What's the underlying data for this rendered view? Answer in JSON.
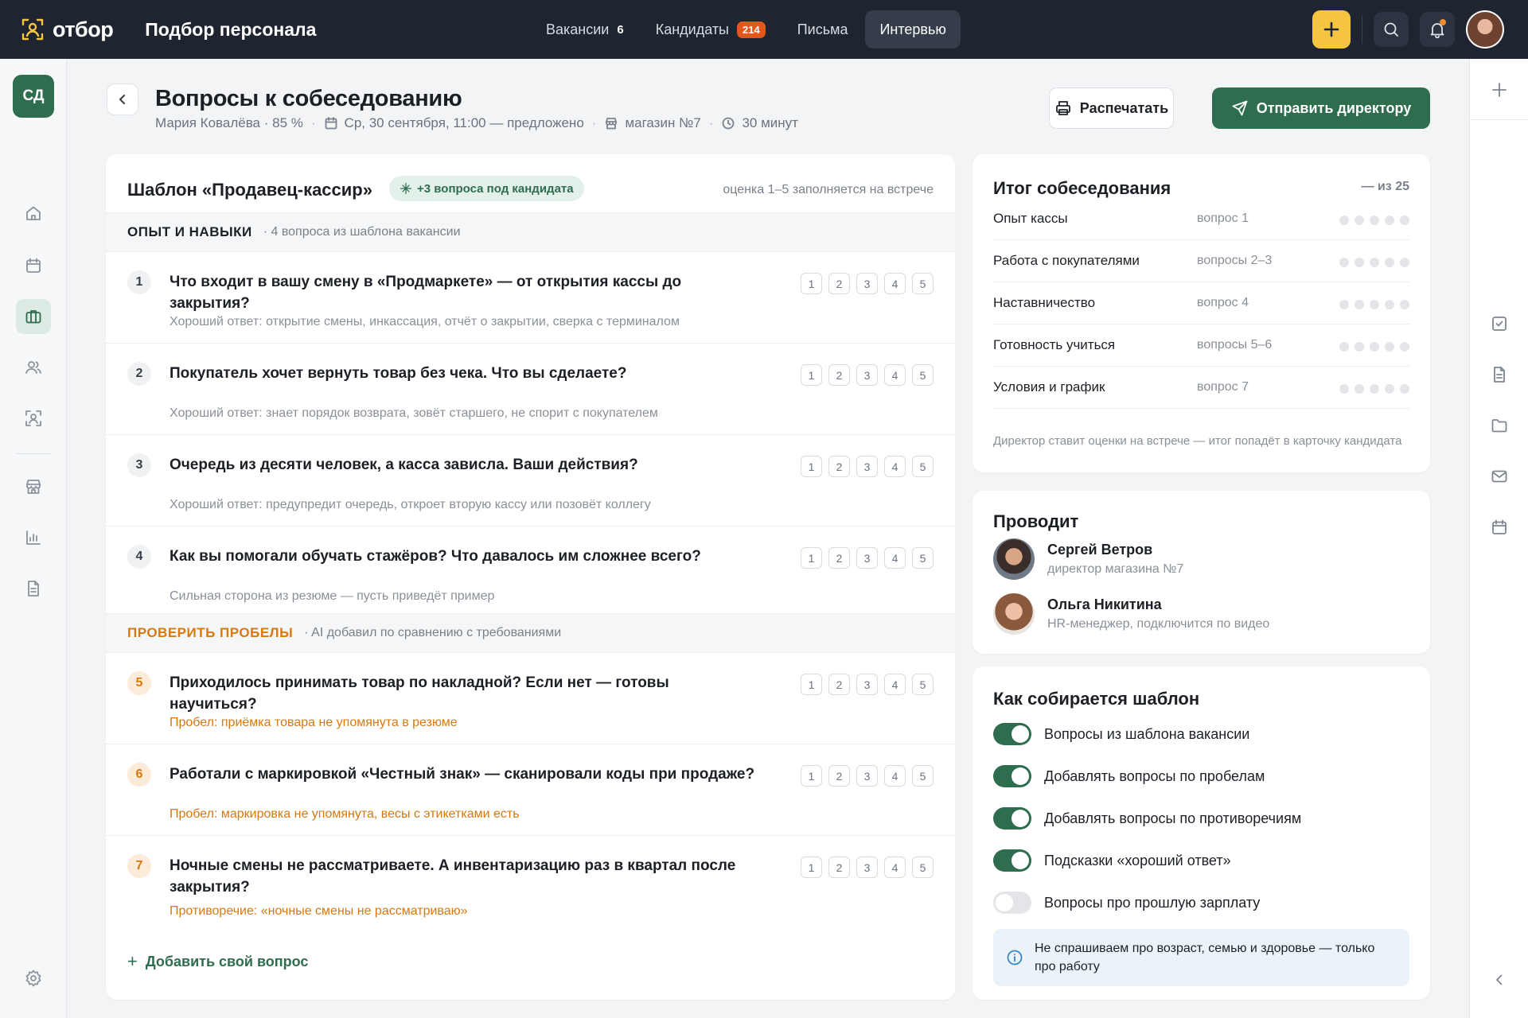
{
  "app": {
    "logo_text": "отбор",
    "title": "Подбор персонала"
  },
  "nav": [
    {
      "label": "Вакансии",
      "count": "6"
    },
    {
      "label": "Кандидаты",
      "badge": "214"
    },
    {
      "label": "Письма"
    },
    {
      "label": "Интервью",
      "active": true
    }
  ],
  "sidebar": {
    "org_initials": "СД",
    "items": [
      "home-icon",
      "calendar-icon",
      "briefcase-icon",
      "users-icon",
      "candidate-scan-icon",
      "store-icon",
      "chart-icon",
      "document-icon",
      "settings-icon"
    ],
    "active": "briefcase-icon"
  },
  "header": {
    "title": "Вопросы к собеседованию",
    "candidate": "Мария Ковалёва · 85 %",
    "datetime": "Ср, 30 сентября, 11:00 — предложено",
    "store": "магазин №7",
    "duration": "30 минут",
    "print_label": "Распечатать",
    "send_label": "Отправить директору"
  },
  "template": {
    "title": "Шаблон «Продавец-кассир»",
    "chip": "+3 вопроса под кандидата",
    "note": "оценка 1–5 заполняется на встрече",
    "sections": [
      {
        "title": "ОПЫТ И НАВЫКИ",
        "subtitle": "· 4 вопроса из шаблона вакансии"
      },
      {
        "title": "ПРОВЕРИТЬ ПРОБЕЛЫ",
        "subtitle": "· AI добавил по сравнению с требованиями"
      }
    ],
    "score_labels": [
      "1",
      "2",
      "3",
      "4",
      "5"
    ],
    "questions": [
      {
        "num": "1",
        "text": "Что входит в вашу смену в «Продмаркете» — от открытия кассы до закрытия?",
        "hint": "Хороший ответ: открытие смены, инкассация, отчёт о закрытии, сверка с терминалом"
      },
      {
        "num": "2",
        "text": "Покупатель хочет вернуть товар без чека. Что вы сделаете?",
        "hint": "Хороший ответ: знает порядок возврата, зовёт старшего, не спорит с покупателем"
      },
      {
        "num": "3",
        "text": "Очередь из десяти человек, а касса зависла. Ваши действия?",
        "hint": "Хороший ответ: предупредит очередь, откроет вторую кассу или позовёт коллегу"
      },
      {
        "num": "4",
        "text": "Как вы помогали обучать стажёров? Что давалось им сложнее всего?",
        "hint": "Сильная сторона из резюме — пусть приведёт пример"
      },
      {
        "num": "5",
        "text": "Приходилось принимать товар по накладной? Если нет — готовы научиться?",
        "hint": "Пробел: приёмка товара не упомянута в резюме"
      },
      {
        "num": "6",
        "text": "Работали с маркировкой «Честный знак» — сканировали коды при продаже?",
        "hint": "Пробел: маркировка не упомянута, весы с этикетками есть"
      },
      {
        "num": "7",
        "text": "Ночные смены не рассматриваете. А инвентаризацию раз в квартал после закрытия?",
        "hint": "Противоречие: «ночные смены не рассматриваю»"
      }
    ],
    "add_label": "Добавить свой вопрос"
  },
  "summary": {
    "title": "Итог собеседования",
    "total": "— из 25",
    "rows": [
      {
        "name": "Опыт кассы",
        "questions": "вопрос 1"
      },
      {
        "name": "Работа с покупателями",
        "questions": "вопросы 2–3"
      },
      {
        "name": "Наставничество",
        "questions": "вопрос 4"
      },
      {
        "name": "Готовность учиться",
        "questions": "вопросы 5–6"
      },
      {
        "name": "Условия и график",
        "questions": "вопрос 7"
      }
    ],
    "note": "Директор ставит оценки на встрече — итог попадёт в карточку кандидата"
  },
  "conducts": {
    "title": "Проводит",
    "people": [
      {
        "name": "Сергей Ветров",
        "role": "директор магазина №7"
      },
      {
        "name": "Ольга Никитина",
        "role": "HR-менеджер, подключится по видео"
      }
    ]
  },
  "settings": {
    "title": "Как собирается шаблон",
    "toggles": [
      {
        "label": "Вопросы из шаблона вакансии",
        "on": true
      },
      {
        "label": "Добавлять вопросы по пробелам",
        "on": true
      },
      {
        "label": "Добавлять вопросы по противоречиям",
        "on": true
      },
      {
        "label": "Подсказки «хороший ответ»",
        "on": true
      },
      {
        "label": "Вопросы про прошлую зарплату",
        "on": false
      }
    ],
    "info": "Не спрашиваем про возраст, семью и здоровье — только про работу"
  },
  "colors": {
    "accent": "#2e6d4e",
    "warning": "#d9780f",
    "topbar": "#1f2530",
    "plus_button": "#f5c542",
    "badge": "#e4571c"
  }
}
